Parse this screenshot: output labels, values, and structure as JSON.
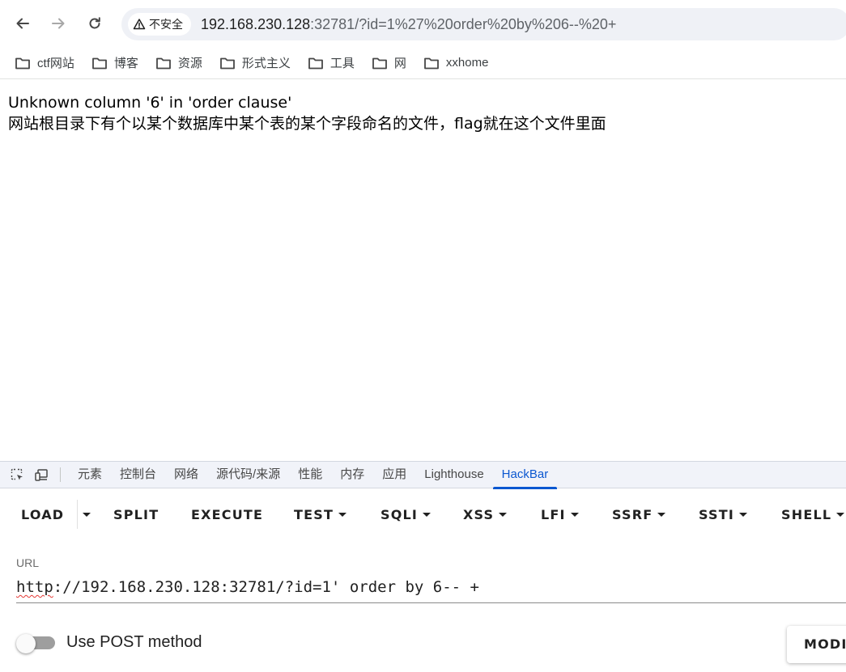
{
  "browser": {
    "security_label": "不安全",
    "url_host": "192.168.230.128",
    "url_rest": ":32781/?id=1%27%20order%20by%206--%20+"
  },
  "bookmarks": [
    {
      "label": "ctf网站",
      "icon": "folder-icon"
    },
    {
      "label": "博客",
      "icon": "folder-icon"
    },
    {
      "label": "资源",
      "icon": "folder-icon"
    },
    {
      "label": "形式主义",
      "icon": "folder-icon"
    },
    {
      "label": "工具",
      "icon": "folder-icon"
    },
    {
      "label": "网",
      "icon": "folder-icon"
    },
    {
      "label": "xxhome",
      "icon": "folder-icon"
    }
  ],
  "page": {
    "line1": "Unknown column '6' in 'order clause'",
    "line2": "网站根目录下有个以某个数据库中某个表的某个字段命名的文件，flag就在这个文件里面"
  },
  "devtools": {
    "tabs": [
      "元素",
      "控制台",
      "网络",
      "源代码/来源",
      "性能",
      "内存",
      "应用",
      "Lighthouse",
      "HackBar"
    ],
    "active_tab": "HackBar"
  },
  "hackbar": {
    "buttons": {
      "load": "LOAD",
      "split": "SPLIT",
      "execute": "EXECUTE",
      "test": "TEST",
      "sqli": "SQLI",
      "xss": "XSS",
      "lfi": "LFI",
      "ssrf": "SSRF",
      "ssti": "SSTI",
      "shell": "SHELL"
    },
    "url_label": "URL",
    "url_scheme": "http",
    "url_value": "://192.168.230.128:32781/?id=1' order by 6-- +",
    "post_label": "Use POST method",
    "post_enabled": false,
    "modify_label": "MODIFY"
  }
}
